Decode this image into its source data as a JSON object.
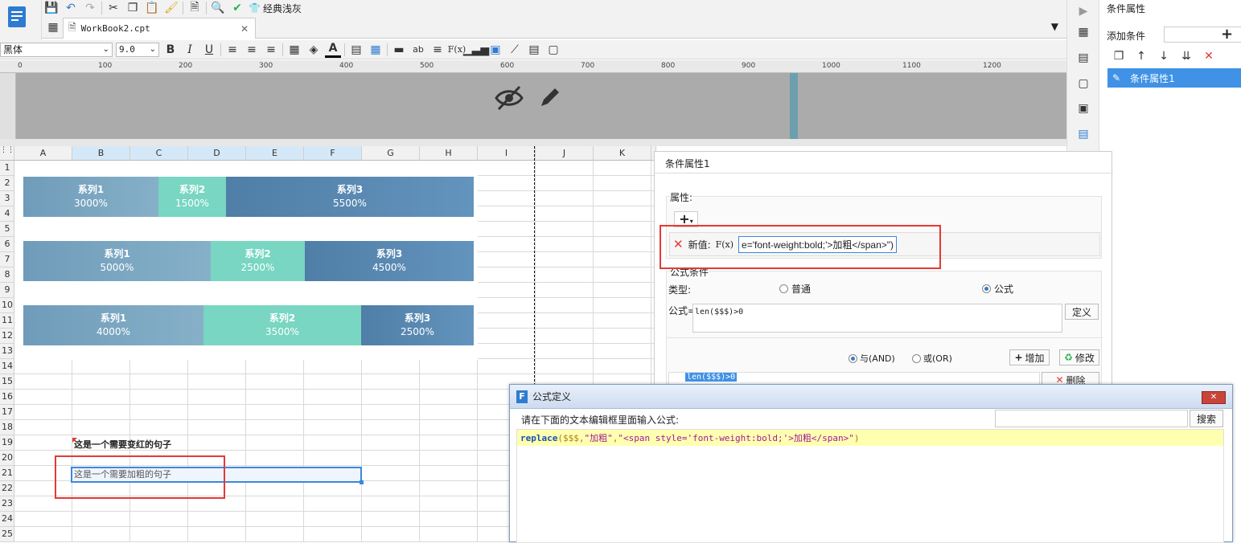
{
  "toolbar": {
    "theme_label": "经典浅灰"
  },
  "tab": {
    "title": "WorkBook2.cpt"
  },
  "format": {
    "font_name": "黑体",
    "font_size": "9.0"
  },
  "ruler": {
    "ticks": [
      "0",
      "100",
      "200",
      "300",
      "400",
      "500",
      "600",
      "700",
      "800",
      "900",
      "1000",
      "1100",
      "1200"
    ]
  },
  "columns": [
    "A",
    "B",
    "C",
    "D",
    "E",
    "F",
    "G",
    "H",
    "I",
    "J",
    "K"
  ],
  "rows": [
    "1",
    "2",
    "3",
    "4",
    "5",
    "6",
    "7",
    "8",
    "9",
    "10",
    "11",
    "12",
    "13",
    "14",
    "15",
    "16",
    "17",
    "18",
    "19",
    "20",
    "21",
    "22",
    "23",
    "24",
    "25"
  ],
  "bars": [
    [
      {
        "name": "系列1",
        "pct": "3000%",
        "color": "#7aa8c2"
      },
      {
        "name": "系列2",
        "pct": "1500%",
        "color": "#7cd8c4"
      },
      {
        "name": "系列3",
        "pct": "5500%",
        "color": "#5b8db5"
      }
    ],
    [
      {
        "name": "系列1",
        "pct": "5000%",
        "color": "#7aa8c2"
      },
      {
        "name": "系列2",
        "pct": "2500%",
        "color": "#7cd8c4"
      },
      {
        "name": "系列3",
        "pct": "4500%",
        "color": "#5b8db5"
      }
    ],
    [
      {
        "name": "系列1",
        "pct": "4000%",
        "color": "#7aa8c2"
      },
      {
        "name": "系列2",
        "pct": "3500%",
        "color": "#7cd8c4"
      },
      {
        "name": "系列3",
        "pct": "2500%",
        "color": "#5b8db5"
      }
    ]
  ],
  "cells": {
    "b19": "这是一个需要变红的句子",
    "b21": "这是一个需要加粗的句子"
  },
  "right_panel": {
    "title": "条件属性",
    "add_label": "添加条件",
    "item": "条件属性1"
  },
  "cond_dialog": {
    "title": "条件属性1",
    "attr_label": "属性:",
    "new_value_label": "新值:",
    "new_value": "e='font-weight:bold;'>加粗</span>\")",
    "formula_cond_label": "公式条件",
    "type_label": "类型:",
    "type_normal": "普通",
    "type_formula": "公式",
    "formula_label": "公式=",
    "formula_value": "len($$$)>0",
    "define_btn": "定义",
    "and_label": "与(AND)",
    "or_label": "或(OR)",
    "add_btn": "增加",
    "modify_btn": "修改",
    "delete_btn": "删除",
    "list_item": "len($$$)>0"
  },
  "formula_dialog": {
    "title": "公式定义",
    "prompt": "请在下面的文本编辑框里面输入公式:",
    "search_btn": "搜索",
    "code": {
      "fn": "replace",
      "args1": "($$$,",
      "s1": "\"加粗\"",
      "comma": ",",
      "s2": "\"<span style='font-weight:bold;'>加粗</span>\"",
      "close": ")"
    }
  }
}
